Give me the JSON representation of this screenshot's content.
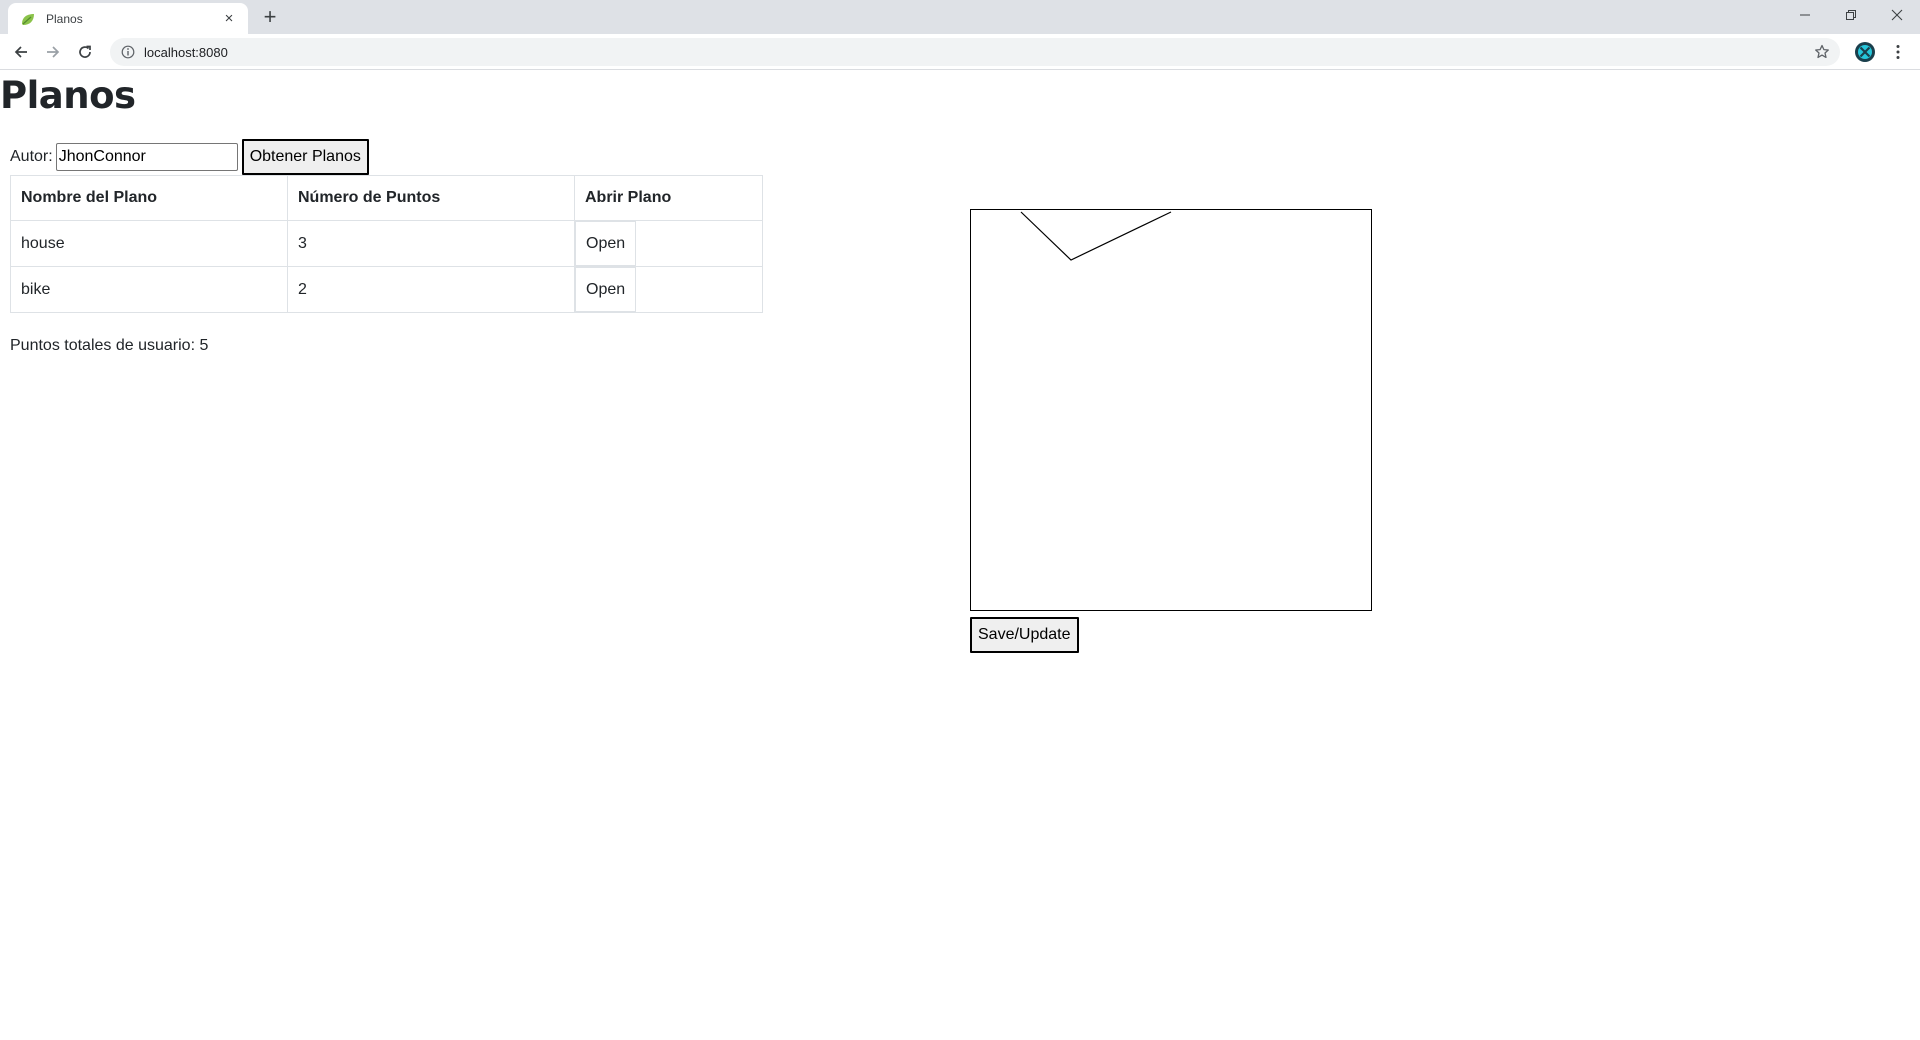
{
  "browser": {
    "tab_title": "Planos",
    "new_tab_symbol": "+",
    "close_symbol": "×",
    "url": "localhost:8080",
    "icons": {
      "favicon": "leaf-favicon-icon",
      "back": "back-arrow-icon",
      "forward": "forward-arrow-icon",
      "reload": "reload-icon",
      "info": "info-icon",
      "star": "star-icon",
      "extension": "extension-icon",
      "menu": "kebab-menu-icon",
      "minimize": "minimize-icon",
      "restore": "restore-icon",
      "close": "close-icon"
    }
  },
  "page": {
    "title": "Planos",
    "author_label": "Autor:",
    "author_value": "JhonConnor",
    "get_plans_label": "Obtener Planos",
    "table": {
      "headers": [
        "Nombre del Plano",
        "Número de Puntos",
        "Abrir Plano"
      ],
      "rows": [
        {
          "name": "house",
          "points": "3",
          "action": "Open"
        },
        {
          "name": "bike",
          "points": "2",
          "action": "Open"
        }
      ]
    },
    "total_points_text": "Puntos totales de usuario: 5",
    "save_label": "Save/Update",
    "canvas": {
      "stroke_color": "#000000"
    }
  }
}
